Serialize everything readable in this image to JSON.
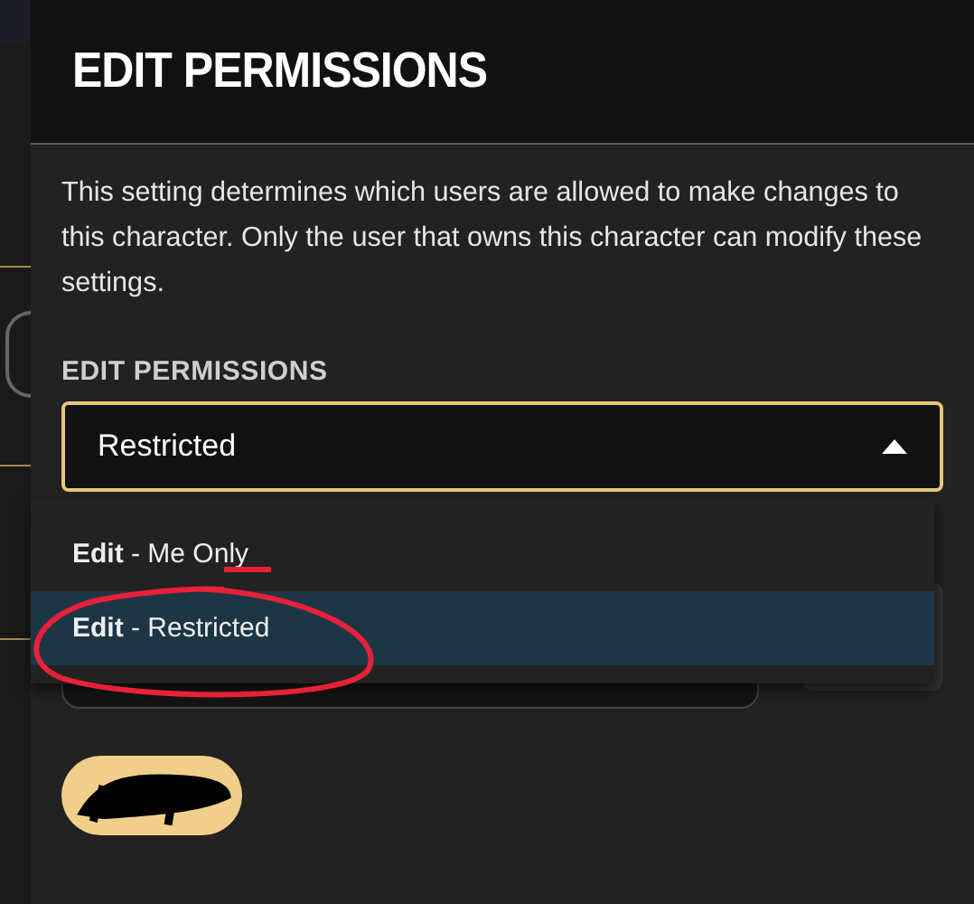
{
  "dialog": {
    "title": "EDIT PERMISSIONS",
    "description": "This setting determines which users are allowed to make changes to this character. Only the user that owns this character can modify these settings."
  },
  "permissions": {
    "label": "EDIT PERMISSIONS",
    "value": "Restricted",
    "expanded": true,
    "options": [
      {
        "label": "**Edit** - Me Only",
        "selected": false
      },
      {
        "label": "**Edit** - Restricted",
        "selected": true
      }
    ]
  }
}
